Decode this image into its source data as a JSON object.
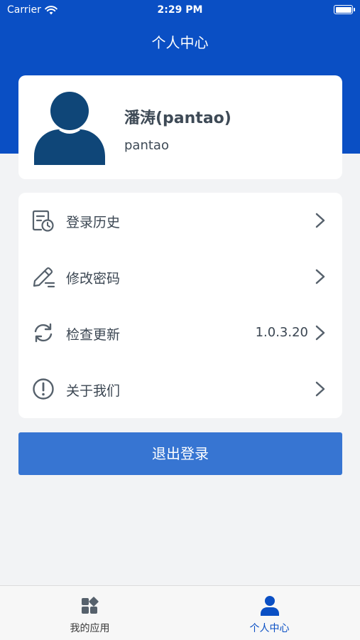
{
  "status_bar": {
    "carrier": "Carrier",
    "time": "2:29 PM"
  },
  "nav": {
    "title": "个人中心"
  },
  "profile": {
    "name": "潘涛(pantao)",
    "username": "pantao"
  },
  "menu": {
    "items": [
      {
        "label": "登录历史",
        "icon": "history-doc-icon",
        "value": ""
      },
      {
        "label": "修改密码",
        "icon": "edit-pen-icon",
        "value": ""
      },
      {
        "label": "检查更新",
        "icon": "refresh-icon",
        "value": "1.0.3.20"
      },
      {
        "label": "关于我们",
        "icon": "info-circle-icon",
        "value": ""
      }
    ]
  },
  "logout": {
    "label": "退出登录"
  },
  "tabs": [
    {
      "label": "我的应用",
      "icon": "apps-grid-icon",
      "active": false
    },
    {
      "label": "个人中心",
      "icon": "person-icon",
      "active": true
    }
  ],
  "colors": {
    "primary": "#0a4fc4",
    "button": "#3775d2",
    "background": "#f2f3f5",
    "avatar": "#0f4678"
  }
}
